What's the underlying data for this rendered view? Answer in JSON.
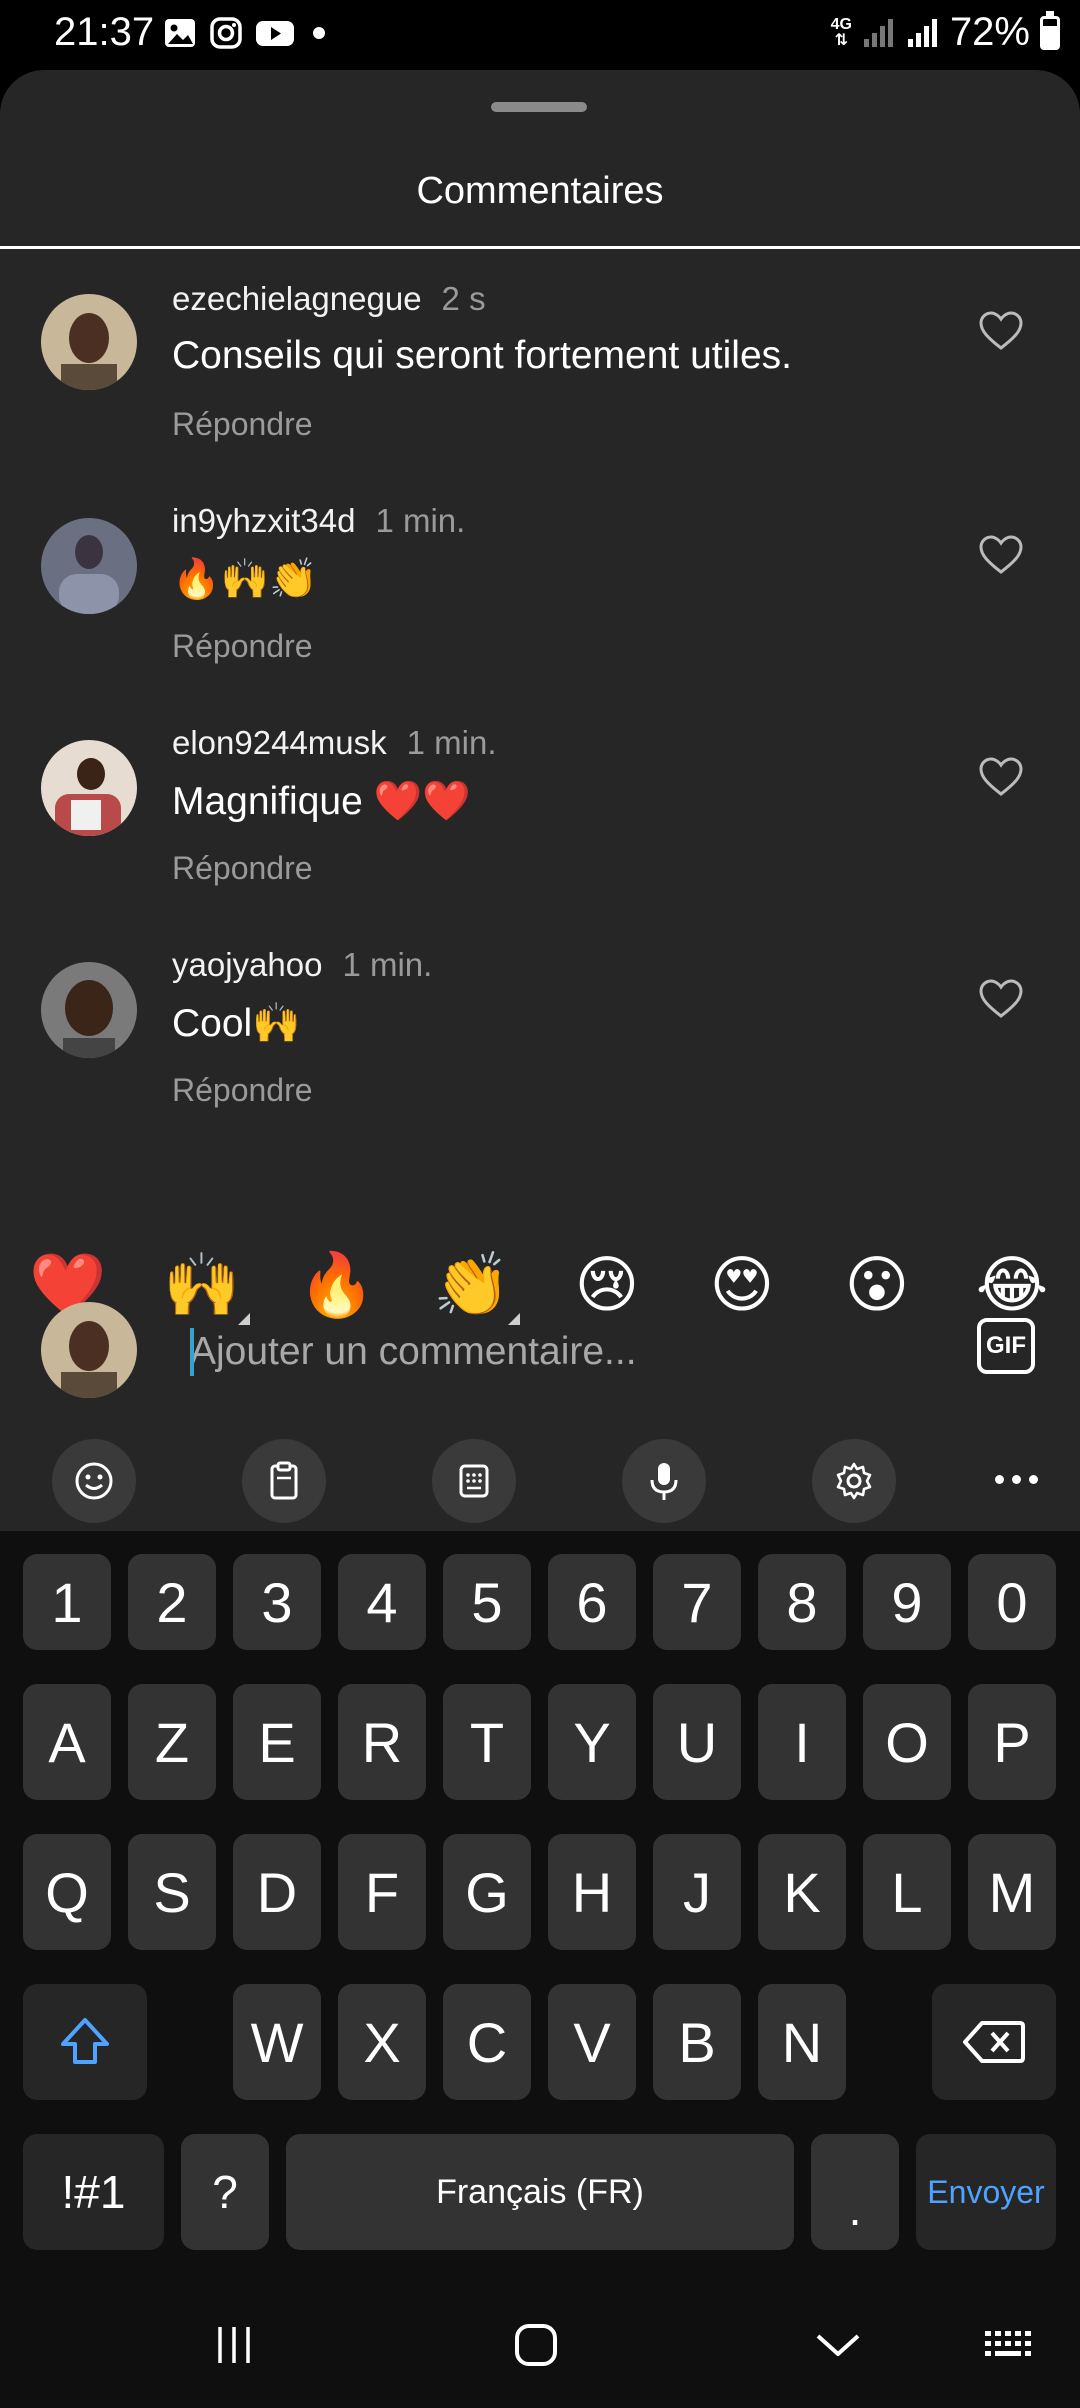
{
  "status_bar": {
    "time": "21:37",
    "network_top": "4G",
    "battery": "72%",
    "notification_icons": [
      "gallery-icon",
      "instagram-icon",
      "youtube-icon"
    ]
  },
  "sheet": {
    "title": "Commentaires"
  },
  "comments": [
    {
      "user": "ezechielagnegue",
      "time": "2 s",
      "text": "Conseils qui seront fortement utiles.",
      "reply": "Répondre"
    },
    {
      "user": "in9yhzxit34d",
      "time": "1 min.",
      "text": "🔥🙌👏",
      "reply": "Répondre"
    },
    {
      "user": "elon9244musk",
      "time": "1 min.",
      "text": "Magnifique ❤️❤️",
      "reply": "Répondre"
    },
    {
      "user": "yaojyahoo",
      "time": "1 min.",
      "text": "Cool🙌",
      "reply": "Répondre"
    }
  ],
  "quick_reactions": [
    "❤️",
    "🙌",
    "🔥",
    "👏",
    "😢",
    "😍",
    "😮",
    "😂"
  ],
  "input": {
    "placeholder": "Ajouter un commentaire...",
    "gif_label": "GIF"
  },
  "keyboard": {
    "row_numbers": [
      "1",
      "2",
      "3",
      "4",
      "5",
      "6",
      "7",
      "8",
      "9",
      "0"
    ],
    "row1": [
      "A",
      "Z",
      "E",
      "R",
      "T",
      "Y",
      "U",
      "I",
      "O",
      "P"
    ],
    "row2": [
      "Q",
      "S",
      "D",
      "F",
      "G",
      "H",
      "J",
      "K",
      "L",
      "M"
    ],
    "row3": [
      "W",
      "X",
      "C",
      "V",
      "B",
      "N"
    ],
    "symbols_label": "!#1",
    "question_label": "?",
    "space_label": "Français (FR)",
    "period_label": ".",
    "send_label": "Envoyer"
  },
  "colors": {
    "sheet_bg": "#262626",
    "key_bg": "#333333",
    "keyboard_bg": "#0f0f0f",
    "accent_blue": "#4da3ff",
    "muted_text": "#9a9a9a"
  }
}
